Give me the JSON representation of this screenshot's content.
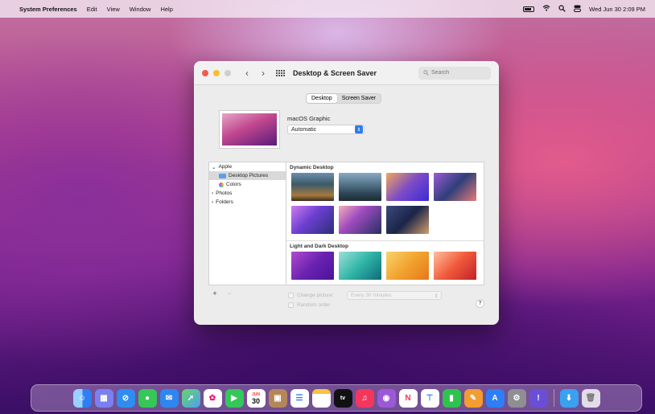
{
  "menubar": {
    "apple": "",
    "app": "System Preferences",
    "menus": [
      "Edit",
      "View",
      "Window",
      "Help"
    ],
    "clock": "Wed Jun 30  2:09 PM"
  },
  "window": {
    "title": "Desktop & Screen Saver",
    "search_placeholder": "Search",
    "tabs": [
      "Desktop",
      "Screen Saver"
    ],
    "active_tab": "Desktop",
    "picture_name": "macOS Graphic",
    "mode": "Automatic",
    "sources": {
      "apple": "Apple",
      "desktop_pictures": "Desktop Pictures",
      "colors": "Colors",
      "photos": "Photos",
      "folders": "Folders"
    },
    "sections": {
      "dynamic": "Dynamic Desktop",
      "light_dark": "Light and Dark Desktop"
    },
    "change_picture": "Change picture:",
    "interval": "Every 30 minutes",
    "random_order": "Random order",
    "plus": "+",
    "minus": "−",
    "help": "?"
  },
  "dock": {
    "calendar_day": "30",
    "calendar_month": "JUN",
    "tv": "tv"
  }
}
